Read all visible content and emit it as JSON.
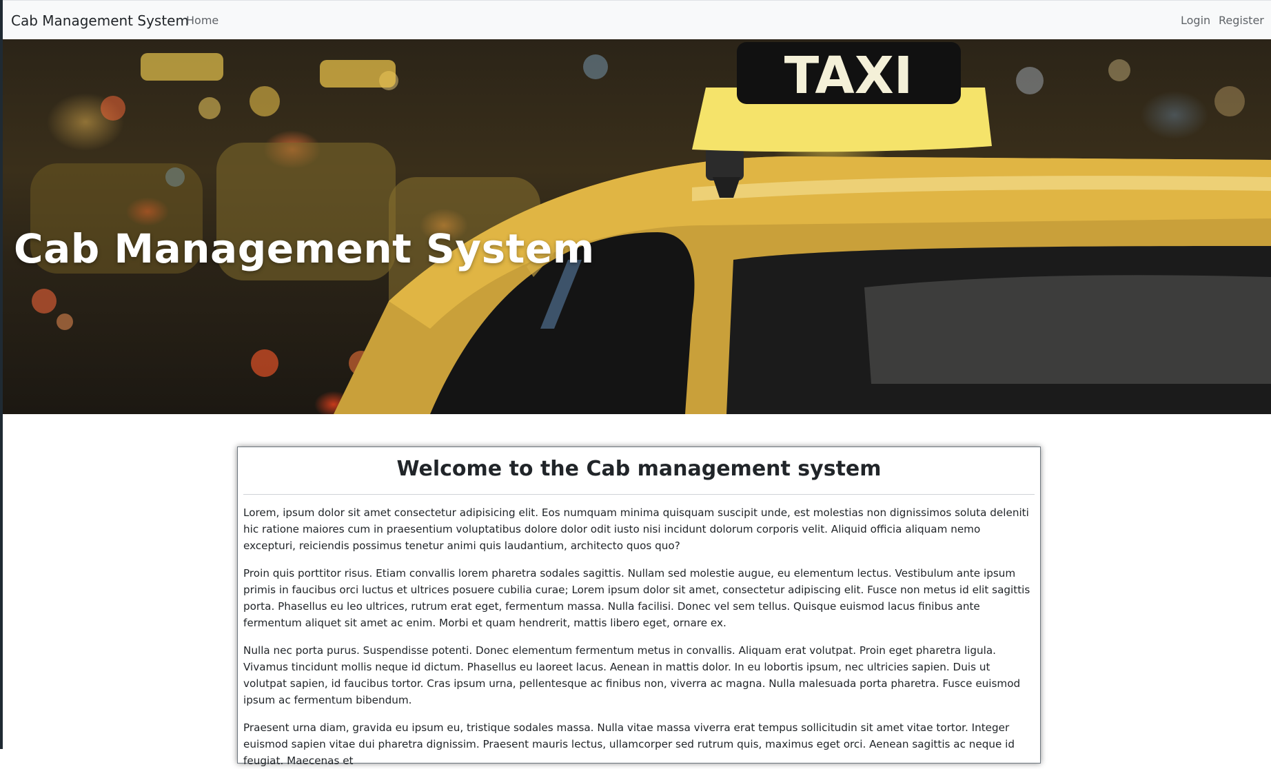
{
  "navbar": {
    "brand": "Cab Management System",
    "home": "Home",
    "login": "Login",
    "register": "Register"
  },
  "hero": {
    "title": "Cab Management System",
    "sign_text": "TAXI"
  },
  "welcome": {
    "heading": "Welcome to the Cab management system",
    "paragraphs": [
      "Lorem, ipsum dolor sit amet consectetur adipisicing elit. Eos numquam minima quisquam suscipit unde, est molestias non dignissimos soluta deleniti hic ratione maiores cum in praesentium voluptatibus dolore dolor odit iusto nisi incidunt dolorum corporis velit. Aliquid officia aliquam nemo excepturi, reiciendis possimus tenetur animi quis laudantium, architecto quos quo?",
      "Proin quis porttitor risus. Etiam convallis lorem pharetra sodales sagittis. Nullam sed molestie augue, eu elementum lectus. Vestibulum ante ipsum primis in faucibus orci luctus et ultrices posuere cubilia curae; Lorem ipsum dolor sit amet, consectetur adipiscing elit. Fusce non metus id elit sagittis porta. Phasellus eu leo ultrices, rutrum erat eget, fermentum massa. Nulla facilisi. Donec vel sem tellus. Quisque euismod lacus finibus ante fermentum aliquet sit amet ac enim. Morbi et quam hendrerit, mattis libero eget, ornare ex.",
      "Nulla nec porta purus. Suspendisse potenti. Donec elementum fermentum metus in convallis. Aliquam erat volutpat. Proin eget pharetra ligula. Vivamus tincidunt mollis neque id dictum. Phasellus eu laoreet lacus. Aenean in mattis dolor. In eu lobortis ipsum, nec ultricies sapien. Duis ut volutpat sapien, id faucibus tortor. Cras ipsum urna, pellentesque ac finibus non, viverra ac magna. Nulla malesuada porta pharetra. Fusce euismod ipsum ac fermentum bibendum.",
      "Praesent urna diam, gravida eu ipsum eu, tristique sodales massa. Nulla vitae massa viverra erat tempus sollicitudin sit amet vitae tortor. Integer euismod sapien vitae dui pharetra dignissim. Praesent mauris lectus, ullamcorper sed rutrum quis, maximus eget orci. Aenean sagittis ac neque id feugiat. Maecenas et"
    ]
  }
}
